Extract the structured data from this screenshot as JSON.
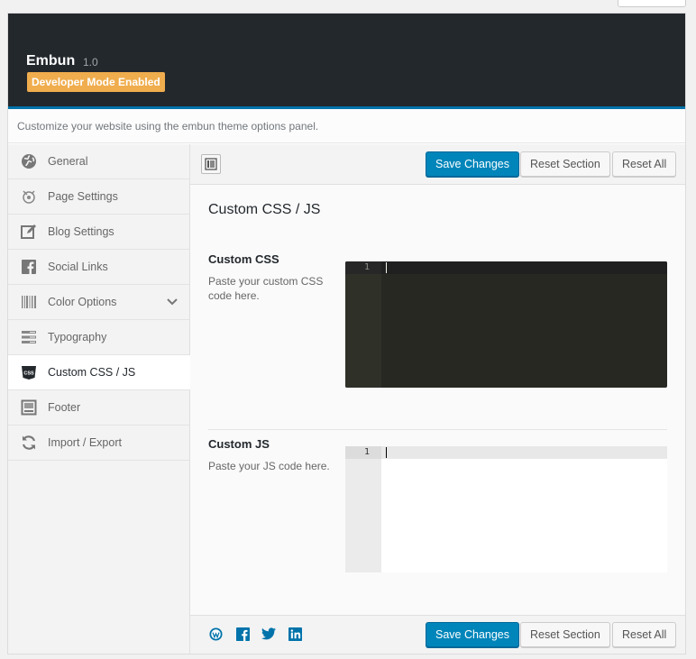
{
  "header": {
    "title": "Embun",
    "version": "1.0",
    "badge": "Developer Mode Enabled"
  },
  "subheader": {
    "text": "Customize your website using the embun theme options panel."
  },
  "sidebar": {
    "items": [
      {
        "label": "General",
        "icon": "globe-icon"
      },
      {
        "label": "Page Settings",
        "icon": "page-settings-icon"
      },
      {
        "label": "Blog Settings",
        "icon": "edit-icon"
      },
      {
        "label": "Social Links",
        "icon": "facebook-icon"
      },
      {
        "label": "Color Options",
        "icon": "barcode-icon",
        "has_submenu": true
      },
      {
        "label": "Typography",
        "icon": "typography-icon"
      },
      {
        "label": "Custom CSS / JS",
        "icon": "css-icon",
        "active": true
      },
      {
        "label": "Footer",
        "icon": "footer-icon"
      },
      {
        "label": "Import / Export",
        "icon": "refresh-icon"
      }
    ]
  },
  "toolbar": {
    "save_label": "Save Changes",
    "reset_section_label": "Reset Section",
    "reset_all_label": "Reset All"
  },
  "main": {
    "section_title": "Custom CSS / JS",
    "fields": [
      {
        "label": "Custom CSS",
        "description": "Paste your custom CSS code here.",
        "line_number": "1",
        "value": ""
      },
      {
        "label": "Custom JS",
        "description": "Paste your JS code here.",
        "line_number": "1",
        "value": ""
      }
    ]
  },
  "footer": {
    "social_icons": [
      "wordpress-icon",
      "facebook-icon",
      "twitter-icon",
      "linkedin-icon"
    ],
    "save_label": "Save Changes",
    "reset_section_label": "Reset Section",
    "reset_all_label": "Reset All"
  },
  "colors": {
    "header_bg": "#23282d",
    "accent": "#0073aa",
    "badge": "#f0ad4e",
    "primary_button": "#0085ba",
    "css_editor_bg": "#272822"
  }
}
